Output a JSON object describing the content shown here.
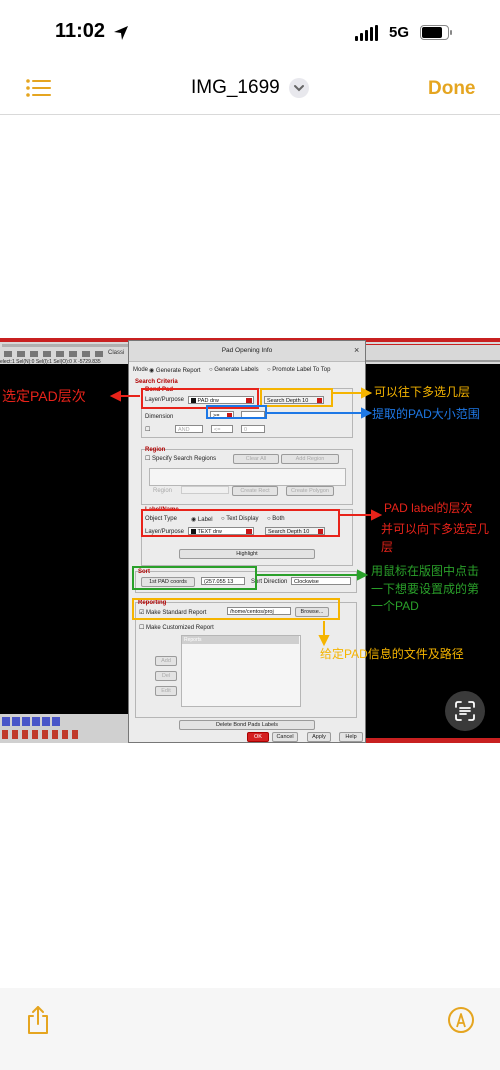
{
  "status_bar": {
    "time": "11:02",
    "network": "5G"
  },
  "nav": {
    "title": "IMG_1699",
    "done_label": "Done"
  },
  "colors": {
    "accent": "#e5a520",
    "annotation_red": "#e8231a",
    "annotation_blue": "#1e78e6",
    "annotation_yellow": "#f5b400",
    "annotation_green": "#2aa02a"
  },
  "icons": {
    "menu": "list-icon",
    "share": "share-icon",
    "markup": "markup-pen-icon",
    "live_text": "text-scan-icon"
  },
  "screenshot": {
    "left_toolbar": {
      "status": "elect:1  Sel(N):0  Sel(I):1  Sel(O):0  X  -5729.835",
      "classic": "Classi"
    },
    "dialog": {
      "title": "Pad Opening Info",
      "close": "×",
      "mode": {
        "label": "Mode",
        "options": [
          "Generate Report",
          "Generate Labels",
          "Promote Label To Top"
        ]
      },
      "search_criteria": "Search Criteria",
      "bond_pad": {
        "title": "Bond Pad",
        "layer_label": "Layer/Purpose",
        "layer_value": "PAD drw",
        "search_depth": "Search Depth 10",
        "dimension_label": "Dimension",
        "dimension_op": ">=",
        "and_label": "AND",
        "and_op": "<=",
        "and_value": "0"
      },
      "region": {
        "title": "Region",
        "specify": "Specify Search Regions",
        "clear_all": "Clear All",
        "add_region": "Add Region",
        "region_label": "Region",
        "create_rect": "Create Rect",
        "create_polygon": "Create Polygon"
      },
      "label_name": {
        "title": "Label/Name",
        "object_type": "Object Type",
        "types": [
          "Label",
          "Text Display",
          "Both"
        ],
        "layer_label": "Layer/Purpose",
        "layer_value": "TEXT drw",
        "search_depth": "Search Depth 10",
        "highlight": "Highlight"
      },
      "sort": {
        "title": "Sort",
        "coords_button": "1st PAD coords",
        "coords_value": "(257.055 13",
        "direction_label": "Sort Direction",
        "direction_value": "Clockwise"
      },
      "reporting": {
        "title": "Reporting",
        "make_standard": "Make Standard Report",
        "path": "/home/centos/proj",
        "browse": "Browse...",
        "make_customized": "Make Customized Report",
        "list_header": "Reports",
        "side_buttons": [
          "Add",
          "Del",
          "Edit"
        ]
      },
      "delete_labels": "Delete Bond Pads Labels",
      "footer": {
        "ok": "OK",
        "cancel": "Cancel",
        "apply": "Apply",
        "help": "Help"
      }
    },
    "annotations": {
      "pad_layer": "选定PAD层次",
      "depth": "可以往下多选几层",
      "size_range": "提取的PAD大小范围",
      "label_layer_1": "PAD label的层次",
      "label_layer_2": "并可以向下多选定几",
      "label_layer_3": "层",
      "mouse_1": "用鼠标在版图中点击",
      "mouse_2": "一下想要设置成的第",
      "mouse_3": "一个PAD",
      "file_path": "给定PAD信息的文件及路径"
    }
  }
}
